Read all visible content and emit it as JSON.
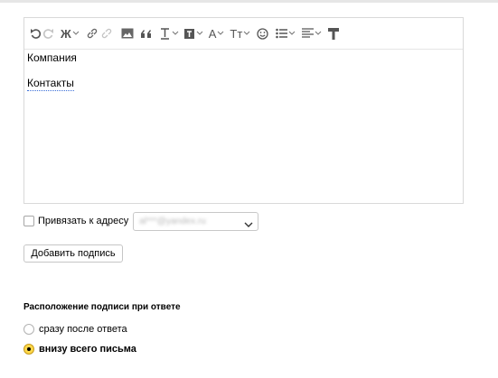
{
  "toolbar": {
    "icons": [
      "undo-icon",
      "redo-icon",
      "bold-icon",
      "link-icon",
      "unlink-icon",
      "image-icon",
      "quote-icon",
      "text-style-icon",
      "text-color-icon",
      "text-background-icon",
      "font-size-icon",
      "emoji-icon",
      "list-icon",
      "align-icon",
      "clear-format-icon"
    ],
    "bold_glyph": "Ж",
    "font_color_glyph": "A",
    "font_size_glyph": "Тт"
  },
  "editor": {
    "lines": [
      "Компания",
      "Контакты"
    ]
  },
  "bind_address": {
    "label": "Привязать к адресу",
    "checked": false,
    "select_value": "al***@yandex.ru"
  },
  "add_signature_button": "Добавить подпись",
  "placement": {
    "title": "Расположение подписи при ответе",
    "options": [
      {
        "label": "сразу после ответа",
        "selected": false
      },
      {
        "label": "внизу всего письма",
        "selected": true
      }
    ]
  },
  "colors": {
    "accent_radio": "#ffd84a",
    "link_underline": "#3b6fd8",
    "border": "#d9d9d9"
  }
}
